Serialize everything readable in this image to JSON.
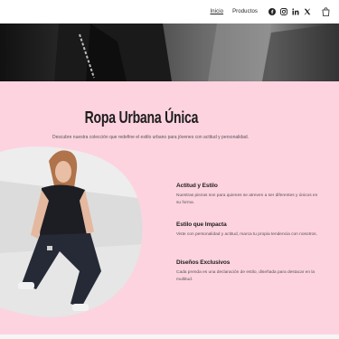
{
  "nav": {
    "links": [
      {
        "label": "Inicio",
        "active": true
      },
      {
        "label": "Productos",
        "active": false
      }
    ],
    "social": [
      "facebook-icon",
      "instagram-icon",
      "linkedin-icon",
      "x-icon"
    ],
    "cart_icon": "shopping-bag-icon"
  },
  "section": {
    "title": "Ropa Urbana Única",
    "subtitle": "Descubre nuestra colección que redefine el estilo urbano para jóvenes con actitud y personalidad.",
    "background": "#fdd3e0"
  },
  "features": [
    {
      "title": "Actitud y Estilo",
      "text": "Nuestras piezas son para quienes se atreven a ser diferentes y únicos en su forma."
    },
    {
      "title": "Estilo que Impacta",
      "text": "Viste con personalidad y actitud, marca tu propia tendencia con nosotros."
    },
    {
      "title": "Diseños Exclusivos",
      "text": "Cada prenda es una declaración de estilo, diseñada para destacar en la multitud."
    }
  ]
}
